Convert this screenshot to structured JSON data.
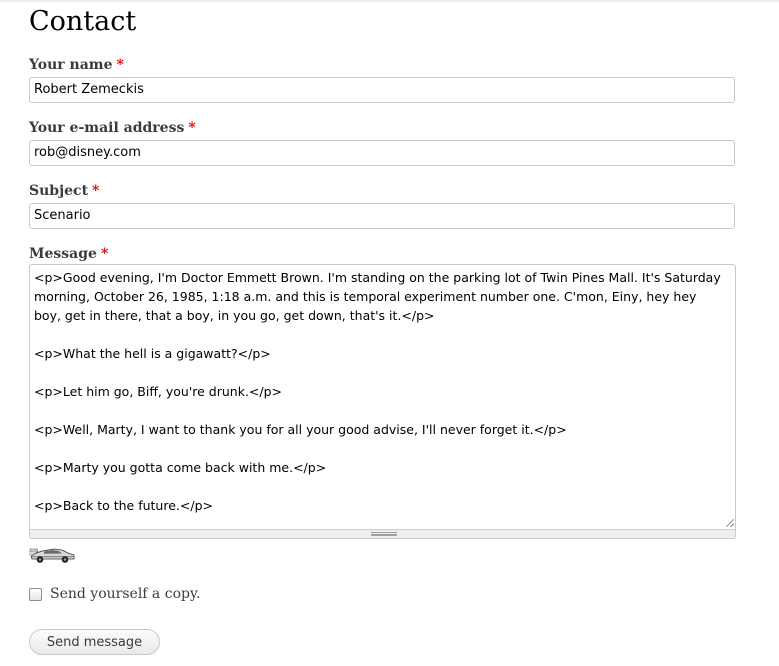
{
  "page": {
    "title": "Contact"
  },
  "form": {
    "required_marker": "*",
    "name": {
      "label": "Your name",
      "value": "Robert Zemeckis"
    },
    "email": {
      "label": "Your e-mail address",
      "value": "rob@disney.com"
    },
    "subject": {
      "label": "Subject",
      "value": "Scenario"
    },
    "message": {
      "label": "Message",
      "paragraphs": [
        "<p>Good evening, I'm Doctor Emmett Brown. I'm standing on the parking lot of Twin Pines Mall. It's Saturday morning, October 26, 1985, 1:18 a.m. and this is temporal experiment number one. C'mon, Einy, hey hey boy, get in there, that a boy, in you go, get down, that's it.</p>",
        "<p>What the hell is a gigawatt?</p>",
        "<p>Let him go, Biff, you're drunk.</p>",
        "<p>Well, Marty, I want to thank you for all your good advise, I'll never forget it.</p>",
        "<p>Marty you gotta come back with me.</p>",
        "<p>Back to the future.</p>"
      ]
    },
    "copy_checkbox": {
      "label": "Send yourself a copy.",
      "checked": false
    },
    "submit_label": "Send message"
  },
  "icons": {
    "captcha": "delorean-car-icon"
  },
  "colors": {
    "required": "#e10000",
    "label_text": "#3b3b3b",
    "input_border": "#c8c8c8"
  }
}
